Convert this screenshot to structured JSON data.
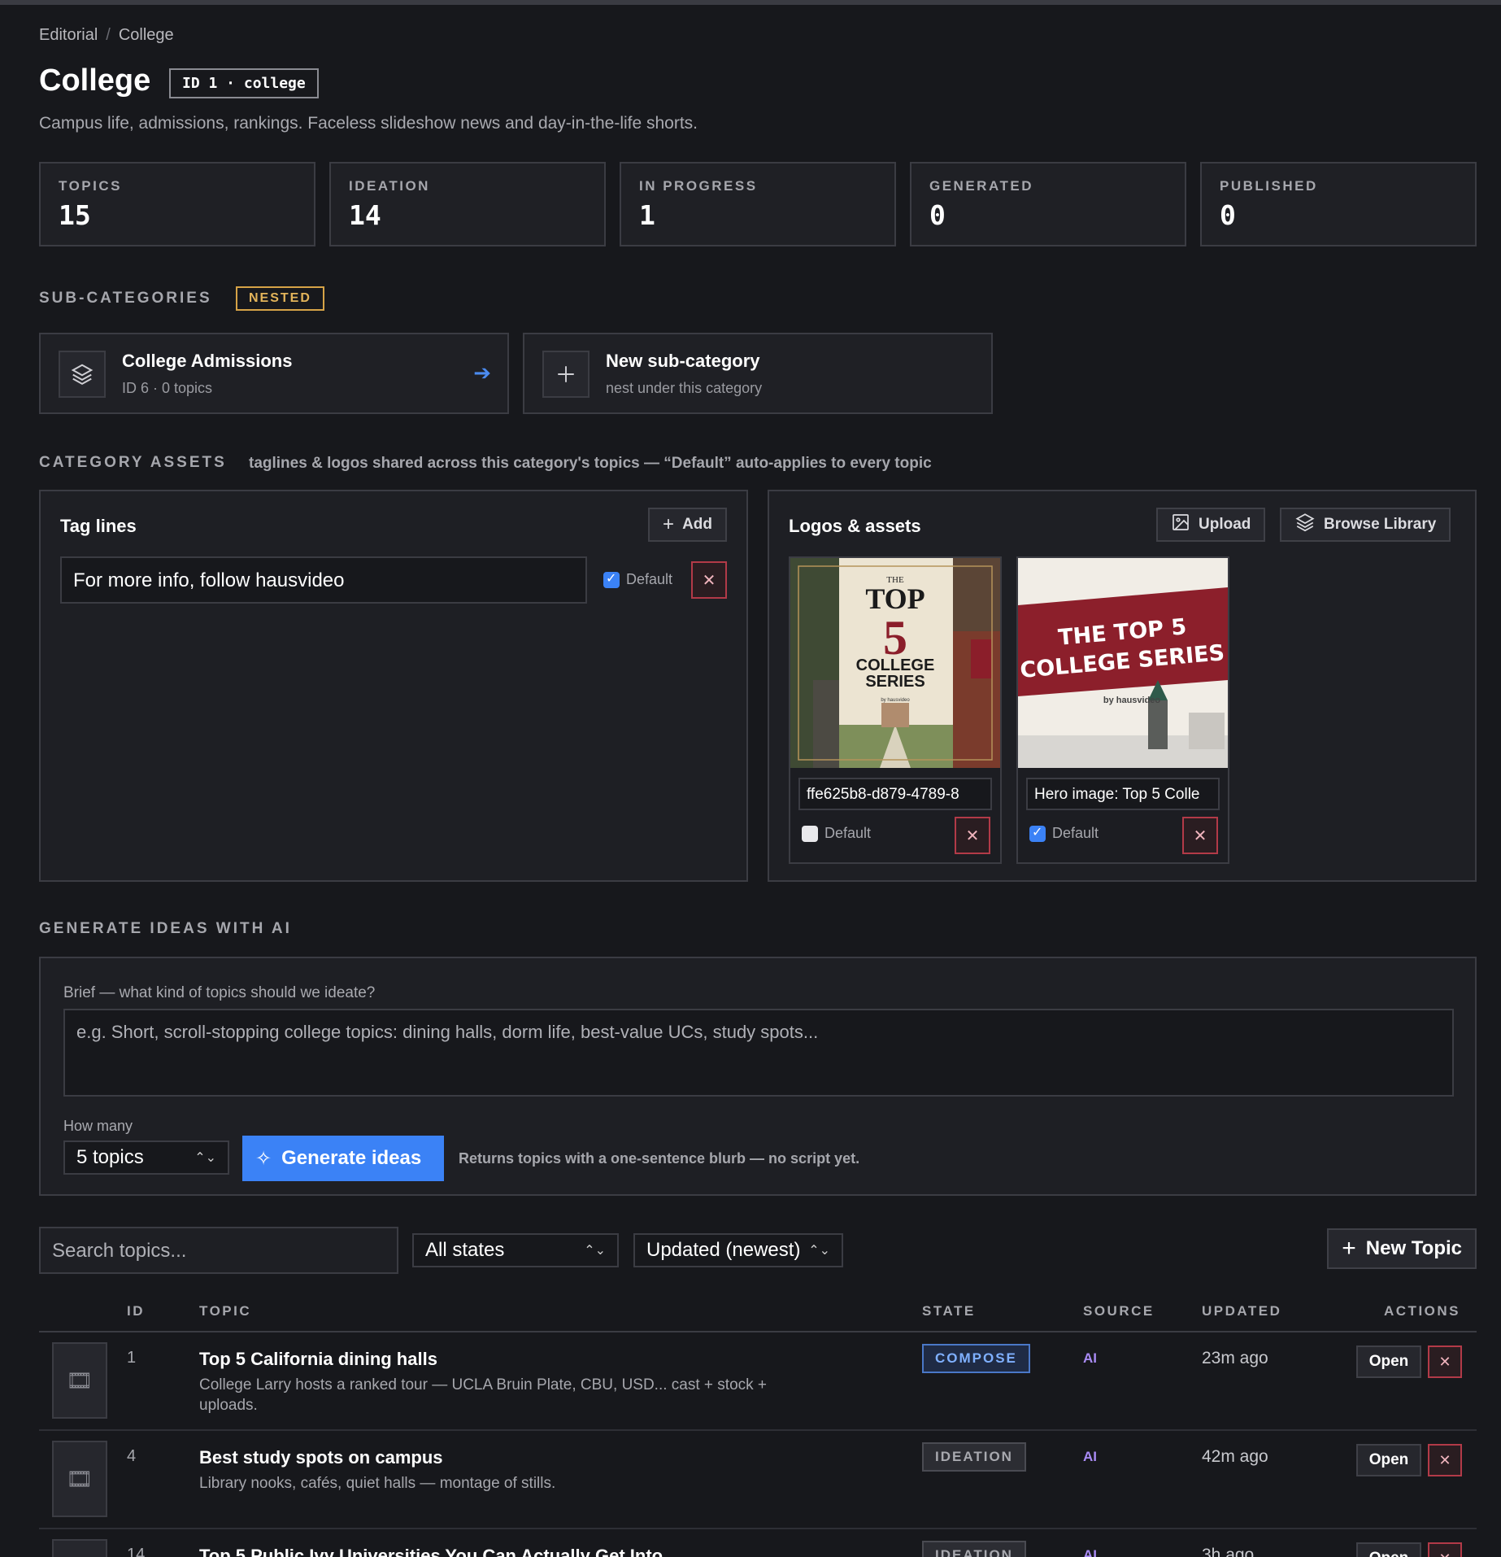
{
  "breadcrumb": {
    "items": [
      "Editorial",
      "College"
    ]
  },
  "header": {
    "title": "College",
    "id_tag": "ID 1 · college",
    "description": "Campus life, admissions, rankings. Faceless slideshow news and day-in-the-life shorts."
  },
  "stats": [
    {
      "label": "TOPICS",
      "value": "15"
    },
    {
      "label": "IDEATION",
      "value": "14"
    },
    {
      "label": "IN PROGRESS",
      "value": "1"
    },
    {
      "label": "GENERATED",
      "value": "0"
    },
    {
      "label": "PUBLISHED",
      "value": "0"
    }
  ],
  "subcategories": {
    "heading": "SUB-CATEGORIES",
    "badge": "NESTED",
    "items": [
      {
        "title": "College Admissions",
        "subtitle": "ID 6 · 0 topics",
        "icon": "layers-icon"
      }
    ],
    "new_item": {
      "title": "New sub-category",
      "subtitle": "nest under this category",
      "icon": "plus-icon"
    }
  },
  "assets": {
    "heading": "CATEGORY ASSETS",
    "subheading": "taglines & logos shared across this category's topics — “Default” auto-applies to every topic",
    "taglines": {
      "title": "Tag lines",
      "add_label": "Add",
      "items": [
        {
          "value": "For more info, follow hausvideo",
          "default": true,
          "default_label": "Default"
        }
      ]
    },
    "logos": {
      "title": "Logos & assets",
      "upload_label": "Upload",
      "browse_label": "Browse Library",
      "items": [
        {
          "caption": "ffe625b8-d879-4789-8",
          "default": false,
          "default_label": "Default",
          "art": {
            "line1": "THE",
            "line2": "TOP",
            "line3": "5",
            "line4": "COLLEGE",
            "line5": "SERIES",
            "brand": "by hausvideo"
          }
        },
        {
          "caption": "Hero image: Top 5 Colle",
          "default": true,
          "default_label": "Default",
          "art": {
            "line1": "THE TOP 5",
            "line2": "COLLEGE SERIES",
            "brand": "by hausvideo"
          }
        }
      ]
    }
  },
  "generate": {
    "heading": "GENERATE IDEAS WITH AI",
    "brief_label": "Brief — what kind of topics should we ideate?",
    "brief_placeholder": "e.g. Short, scroll-stopping college topics: dining halls, dorm life, best-value UCs, study spots...",
    "how_many_label": "How many",
    "how_many_value": "5 topics",
    "button_label": "Generate ideas",
    "note": "Returns topics with a one-sentence blurb — no script yet."
  },
  "filters": {
    "search_placeholder": "Search topics...",
    "state_value": "All states",
    "sort_value": "Updated (newest)",
    "new_topic_label": "New Topic"
  },
  "table": {
    "headers": {
      "id": "ID",
      "topic": "TOPIC",
      "state": "STATE",
      "source": "SOURCE",
      "updated": "UPDATED",
      "actions": "ACTIONS"
    },
    "open_label": "Open",
    "rows": [
      {
        "id": "1",
        "title": "Top 5 California dining halls",
        "blurb": "College Larry hosts a ranked tour — UCLA Bruin Plate, CBU, USD... cast + stock + uploads.",
        "state": "COMPOSE",
        "source": "AI",
        "updated": "23m ago"
      },
      {
        "id": "4",
        "title": "Best study spots on campus",
        "blurb": "Library nooks, cafés, quiet halls — montage of stills.",
        "state": "IDEATION",
        "source": "AI",
        "updated": "42m ago"
      },
      {
        "id": "14",
        "title": "Top 5 Public Ivy Universities You Can Actually Get Into",
        "blurb": "",
        "state": "IDEATION",
        "source": "AI",
        "updated": "3h ago"
      }
    ]
  }
}
